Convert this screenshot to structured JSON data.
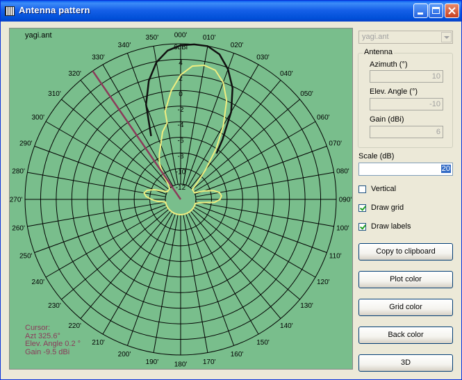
{
  "window": {
    "title": "Antenna pattern",
    "icon": "app-grid-icon"
  },
  "plot": {
    "file_label": "yagi.ant",
    "colors": {
      "background": "#79BE8C",
      "grid": "#000000",
      "pattern": "#F0EE80",
      "outline": "#101010",
      "cursor": "#8B3A5A"
    },
    "radial_labels": [
      "6dBi",
      "4",
      "2",
      "0",
      "-2",
      "-4",
      "-6",
      "-8",
      "-10",
      "-12"
    ],
    "angle_labels": [
      "000'",
      "010'",
      "020'",
      "030'",
      "040'",
      "050'",
      "060'",
      "070'",
      "080'",
      "090'",
      "100'",
      "110'",
      "120'",
      "130'",
      "140'",
      "150'",
      "160'",
      "170'",
      "180'",
      "190'",
      "200'",
      "210'",
      "220'",
      "230'",
      "240'",
      "250'",
      "260'",
      "270'",
      "280'",
      "290'",
      "300'",
      "310'",
      "320'",
      "330'",
      "340'",
      "350'"
    ],
    "cursor_info": [
      "Cursor:",
      "Azt 325.6°",
      "Elev. Angle 0.2 °",
      "Gain -9.5 dBi"
    ],
    "pattern_gain": [
      [
        -10,
        -2.5
      ],
      [
        -5,
        0
      ],
      [
        0,
        2
      ],
      [
        5,
        3.2
      ],
      [
        10,
        3.5
      ],
      [
        15,
        3.2
      ],
      [
        20,
        2
      ],
      [
        25,
        0
      ],
      [
        30,
        -3
      ],
      [
        35,
        -6
      ],
      [
        40,
        -9
      ],
      [
        45,
        -11
      ],
      [
        50,
        -12.5
      ],
      [
        55,
        -13.2
      ],
      [
        60,
        -13.4
      ],
      [
        65,
        -12.3
      ],
      [
        70,
        -10.8
      ],
      [
        75,
        -9.6
      ],
      [
        80,
        -8.9
      ],
      [
        85,
        -8.7
      ],
      [
        90,
        -8.9
      ],
      [
        95,
        -9.6
      ],
      [
        100,
        -11.5
      ],
      [
        105,
        -14
      ],
      [
        110,
        -16
      ],
      [
        115,
        -17.5
      ],
      [
        120,
        -16.5
      ],
      [
        125,
        -15.5
      ],
      [
        130,
        -15
      ],
      [
        135,
        -15
      ],
      [
        140,
        -16
      ],
      [
        145,
        -17
      ],
      [
        150,
        -17.5
      ],
      [
        160,
        -18
      ],
      [
        170,
        -18.5
      ],
      [
        180,
        -19
      ],
      [
        190,
        -18
      ],
      [
        200,
        -18.5
      ],
      [
        210,
        -18
      ],
      [
        220,
        -17.8
      ],
      [
        230,
        -17.8
      ],
      [
        240,
        -17.5
      ],
      [
        250,
        -16
      ],
      [
        255,
        -14
      ],
      [
        260,
        -12.5
      ],
      [
        265,
        -11
      ],
      [
        270,
        -10.2
      ],
      [
        275,
        -9.5
      ],
      [
        280,
        -9.2
      ],
      [
        285,
        -9.5
      ],
      [
        290,
        -10.3
      ],
      [
        295,
        -11.4
      ],
      [
        300,
        -12.6
      ],
      [
        305,
        -13.6
      ],
      [
        310,
        -13.7
      ],
      [
        315,
        -13
      ],
      [
        320,
        -11.5
      ],
      [
        325,
        -10
      ],
      [
        330,
        -8.5
      ],
      [
        335,
        -7.5
      ],
      [
        340,
        -6.5
      ],
      [
        345,
        -5
      ],
      [
        350,
        -4
      ]
    ],
    "envelope_gain": [
      [
        -25,
        -5
      ],
      [
        -20,
        -1
      ],
      [
        -15,
        1.8
      ],
      [
        -10,
        3.9
      ],
      [
        -5,
        5.2
      ],
      [
        0,
        5.8
      ],
      [
        5,
        6
      ],
      [
        10,
        6
      ],
      [
        15,
        5.3
      ],
      [
        20,
        3.8
      ],
      [
        25,
        1.8
      ],
      [
        30,
        -1
      ],
      [
        35,
        -4.6
      ],
      [
        38,
        -6.5
      ]
    ],
    "cursor_azimuth": 325.6
  },
  "controls": {
    "file_select": "yagi.ant",
    "antenna_group": "Antenna",
    "azimuth_label": "Azimuth (°)",
    "azimuth_value": "10",
    "elev_label": "Elev. Angle (°)",
    "elev_value": "-10",
    "gain_label": "Gain (dBi)",
    "gain_value": "6",
    "scale_label": "Scale (dB)",
    "scale_value": "20",
    "vertical_label": "Vertical",
    "vertical_checked": false,
    "draw_grid_label": "Draw grid",
    "draw_grid_checked": true,
    "draw_labels_label": "Draw labels",
    "draw_labels_checked": true,
    "buttons": [
      "Copy to clipboard",
      "Plot color",
      "Grid color",
      "Back color",
      "3D"
    ]
  }
}
